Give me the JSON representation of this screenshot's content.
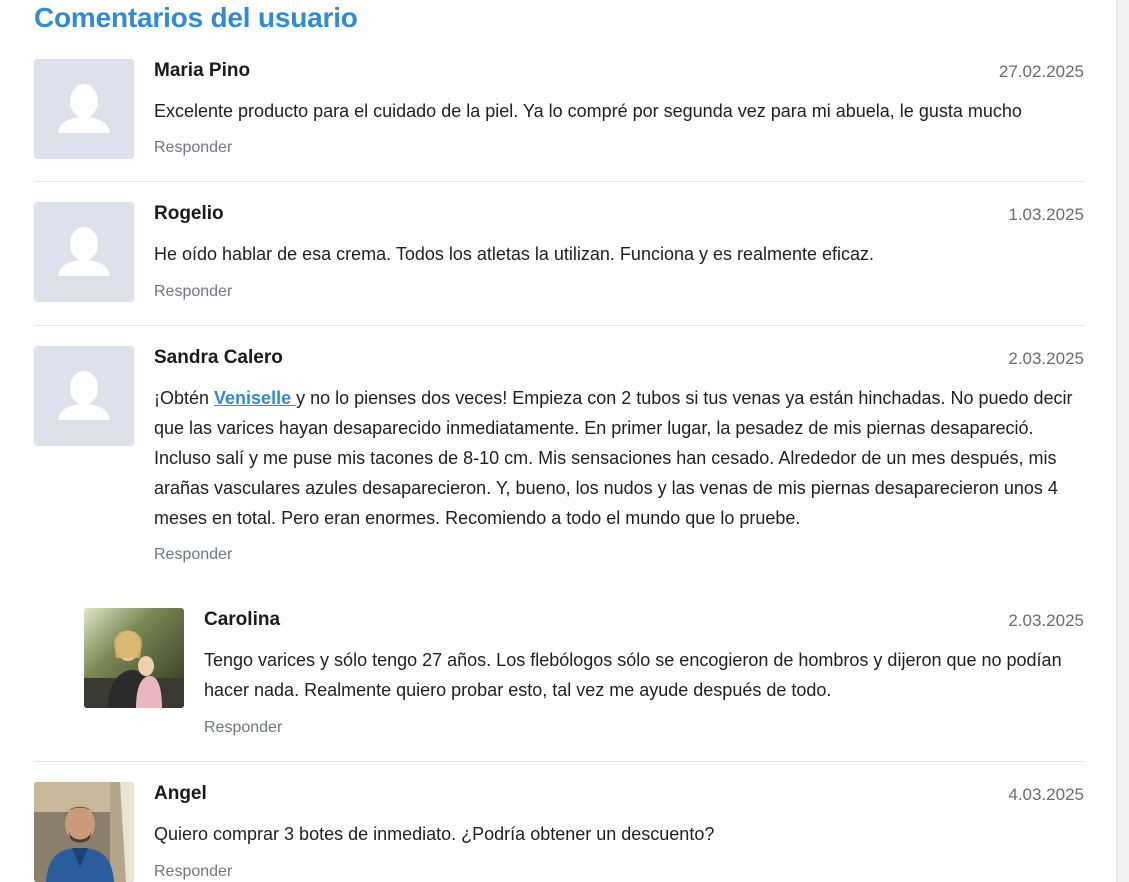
{
  "section_title": "Comentarios del usuario",
  "reply_label": "Responder",
  "comments": [
    {
      "name": "Maria Pino",
      "date": "27.02.2025",
      "avatar": "placeholder-avatar",
      "text": "Excelente producto para el cuidado de la piel. Ya lo compré por segunda vez para mi abuela, le gusta mucho"
    },
    {
      "name": "Rogelio",
      "date": "1.03.2025",
      "avatar": "placeholder-avatar",
      "text": "He oído hablar de esa crema. Todos los atletas la utilizan. Funciona y es realmente eficaz."
    },
    {
      "name": "Sandra Calero",
      "date": "2.03.2025",
      "avatar": "placeholder-avatar",
      "text_before": "¡Obtén ",
      "link_text": "Veniselle ",
      "text_after": "y no lo pienses dos veces! Empieza con 2 tubos si tus venas ya están hinchadas. No puedo decir que las varices hayan desaparecido inmediatamente. En primer lugar, la pesadez de mis piernas desapareció. Incluso salí y me puse mis tacones de 8-10 cm. Mis sensaciones han cesado. Alrededor de un mes después, mis arañas vasculares azules desaparecieron. Y, bueno, los nudos y las venas de mis piernas desaparecieron unos 4 meses en total. Pero eran enormes. Recomiendo a todo el mundo que lo pruebe."
    },
    {
      "name": "Carolina",
      "date": "2.03.2025",
      "avatar": "photo-avatar",
      "reply": true,
      "text": "Tengo varices y sólo tengo 27 años. Los flebólogos sólo se encogieron de hombros y dijeron que no podían hacer nada. Realmente quiero probar esto, tal vez me ayude después de todo."
    },
    {
      "name": "Angel",
      "date": "4.03.2025",
      "avatar": "photo-avatar",
      "text": "Quiero comprar 3 botes de inmediato. ¿Podría obtener un descuento?"
    }
  ],
  "colors": {
    "accent": "#2e8bd4",
    "placeholder_bg": "#dde1ec",
    "muted_text": "#6f7780"
  }
}
